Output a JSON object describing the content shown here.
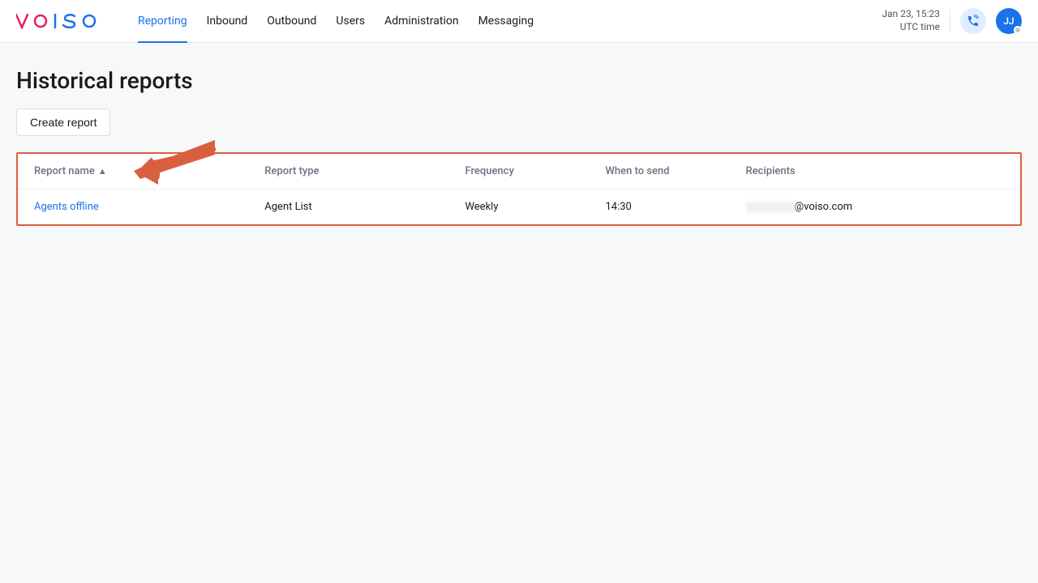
{
  "header": {
    "datetime_line1": "Jan 23, 15:23",
    "datetime_line2": "UTC time",
    "avatar_initials": "JJ"
  },
  "nav": {
    "items": [
      {
        "label": "Reporting",
        "active": true
      },
      {
        "label": "Inbound",
        "active": false
      },
      {
        "label": "Outbound",
        "active": false
      },
      {
        "label": "Users",
        "active": false
      },
      {
        "label": "Administration",
        "active": false
      },
      {
        "label": "Messaging",
        "active": false
      }
    ]
  },
  "page": {
    "title": "Historical reports",
    "create_button": "Create report"
  },
  "table": {
    "headers": {
      "name": "Report name",
      "type": "Report type",
      "freq": "Frequency",
      "when": "When to send",
      "recip": "Recipients"
    },
    "rows": [
      {
        "name": "Agents offline",
        "type": "Agent List",
        "freq": "Weekly",
        "when": "14:30",
        "recip_suffix": "@voiso.com"
      }
    ]
  }
}
